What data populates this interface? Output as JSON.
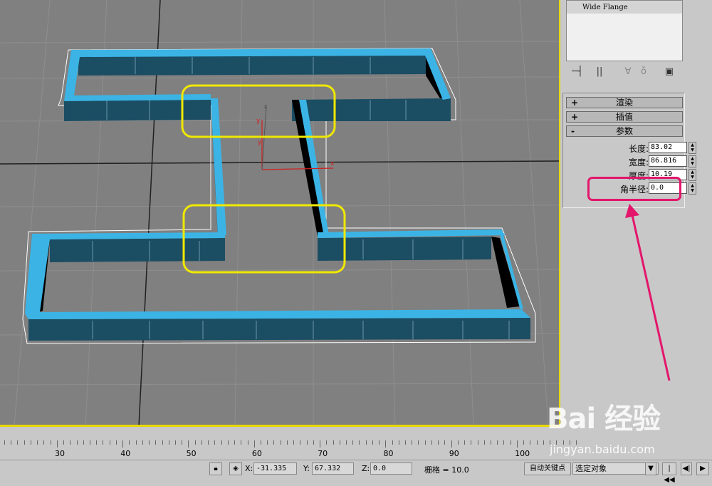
{
  "modifier_list": {
    "items": [
      "Wide Flange"
    ]
  },
  "toolbar_icons": [
    "pin-stack-icon",
    "show-end-result-icon",
    "make-unique-icon",
    "remove-modifier-icon",
    "configure-modifier-sets-icon"
  ],
  "rollouts": {
    "render": {
      "sign": "+",
      "label": "渲染"
    },
    "interpolation": {
      "sign": "+",
      "label": "插值"
    },
    "parameters": {
      "sign": "-",
      "label": "参数"
    }
  },
  "params": [
    {
      "label": "长度:",
      "value": "83.02"
    },
    {
      "label": "宽度:",
      "value": "86.816"
    },
    {
      "label": "厚度:",
      "value": "10.19"
    },
    {
      "label": "角半径:",
      "value": "0.0"
    }
  ],
  "viewport": {
    "axis_labels": {
      "y_top": "y",
      "z_top": "z",
      "y_axis": "y",
      "x_axis": "x"
    },
    "highlight_color": "#f0e800",
    "annotation_color": "#e3166b",
    "object_color": "#1b4d63",
    "edge_color": "#3bb4e5"
  },
  "ruler": {
    "labels": [
      "30",
      "40",
      "50",
      "60",
      "70",
      "80",
      "90",
      "100"
    ]
  },
  "status": {
    "x_label": "X:",
    "x_value": "-31.335",
    "y_label": "Y:",
    "y_value": "67.332",
    "z_label": "Z:",
    "z_value": "0.0",
    "grid_text": "栅格 = 10.0",
    "auto_key": "自动关键点",
    "selection_set": "选定对象",
    "lock_icon": "lock-icon",
    "absolute_mode_icon": "absolute-mode-icon"
  },
  "watermark": {
    "brand": "Bai 经验",
    "url": "jingyan.baidu.com"
  }
}
